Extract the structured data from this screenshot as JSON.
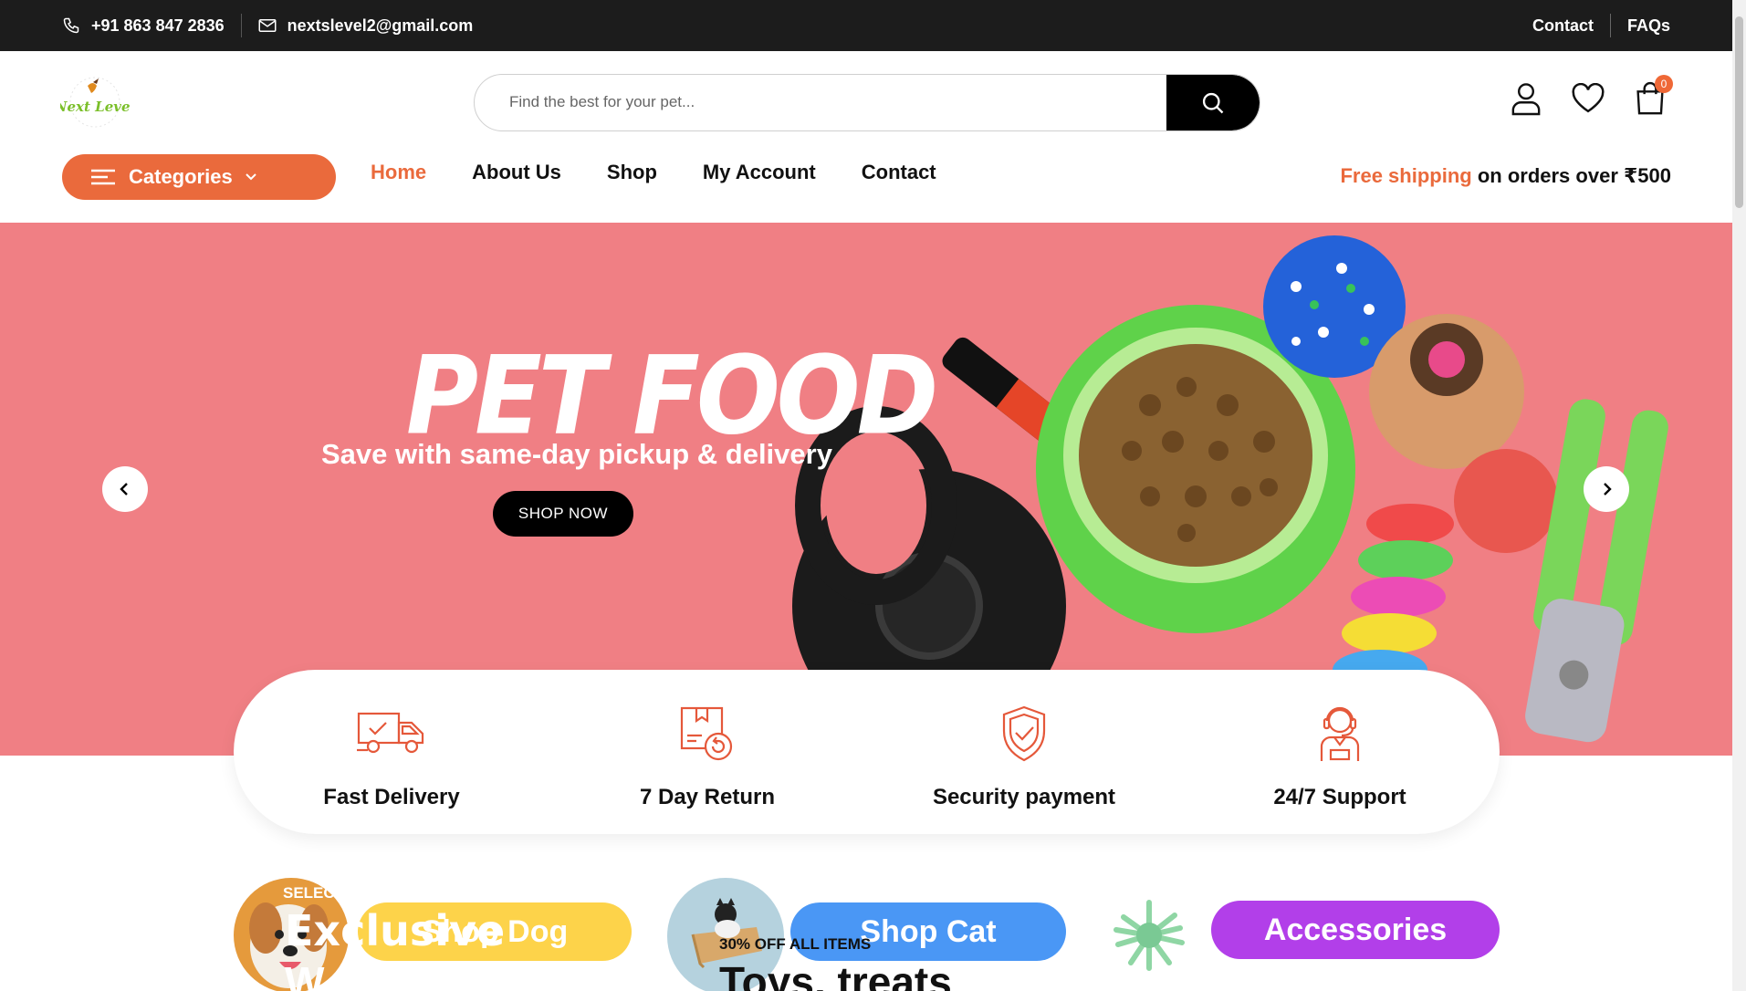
{
  "topbar": {
    "phone": "+91 863 847 2836",
    "email": "nextslevel2@gmail.com",
    "links": [
      "Contact",
      "FAQs"
    ]
  },
  "header": {
    "logo_text": "Next Level",
    "search_placeholder": "Find the best for your pet...",
    "cart_count": "0"
  },
  "nav": {
    "categories_label": "Categories",
    "items": [
      "Home",
      "About Us",
      "Shop",
      "My Account",
      "Contact"
    ],
    "shipping_highlight": "Free shipping",
    "shipping_rest": " on orders over ₹500"
  },
  "hero": {
    "title": "PET FOOD",
    "subtitle": "Save with same-day pickup & delivery",
    "button": "SHOP NOW",
    "colors": {
      "background": "#f07f84"
    }
  },
  "features": [
    {
      "label": "Fast Delivery",
      "icon": "truck-icon"
    },
    {
      "label": "7 Day Return",
      "icon": "return-box-icon"
    },
    {
      "label": "Security payment",
      "icon": "shield-check-icon"
    },
    {
      "label": "24/7 Support",
      "icon": "support-agent-icon"
    }
  ],
  "categories": {
    "dog_pill": "Shop Dog",
    "cat_pill": "Shop Cat",
    "acc_pill": "Accessories",
    "overlay_select": "SELECT",
    "overlay_exclusive": "Exclusive",
    "overlay_w": "W",
    "overlay_off": "30% OFF ALL ITEMS",
    "overlay_toys": "Toys, treats",
    "colors": {
      "dog": "#fdd34a",
      "cat": "#4a97f5",
      "acc": "#b23fe9"
    }
  },
  "colors": {
    "accent": "#ea6a3c",
    "topbar": "#1c1c1c"
  }
}
